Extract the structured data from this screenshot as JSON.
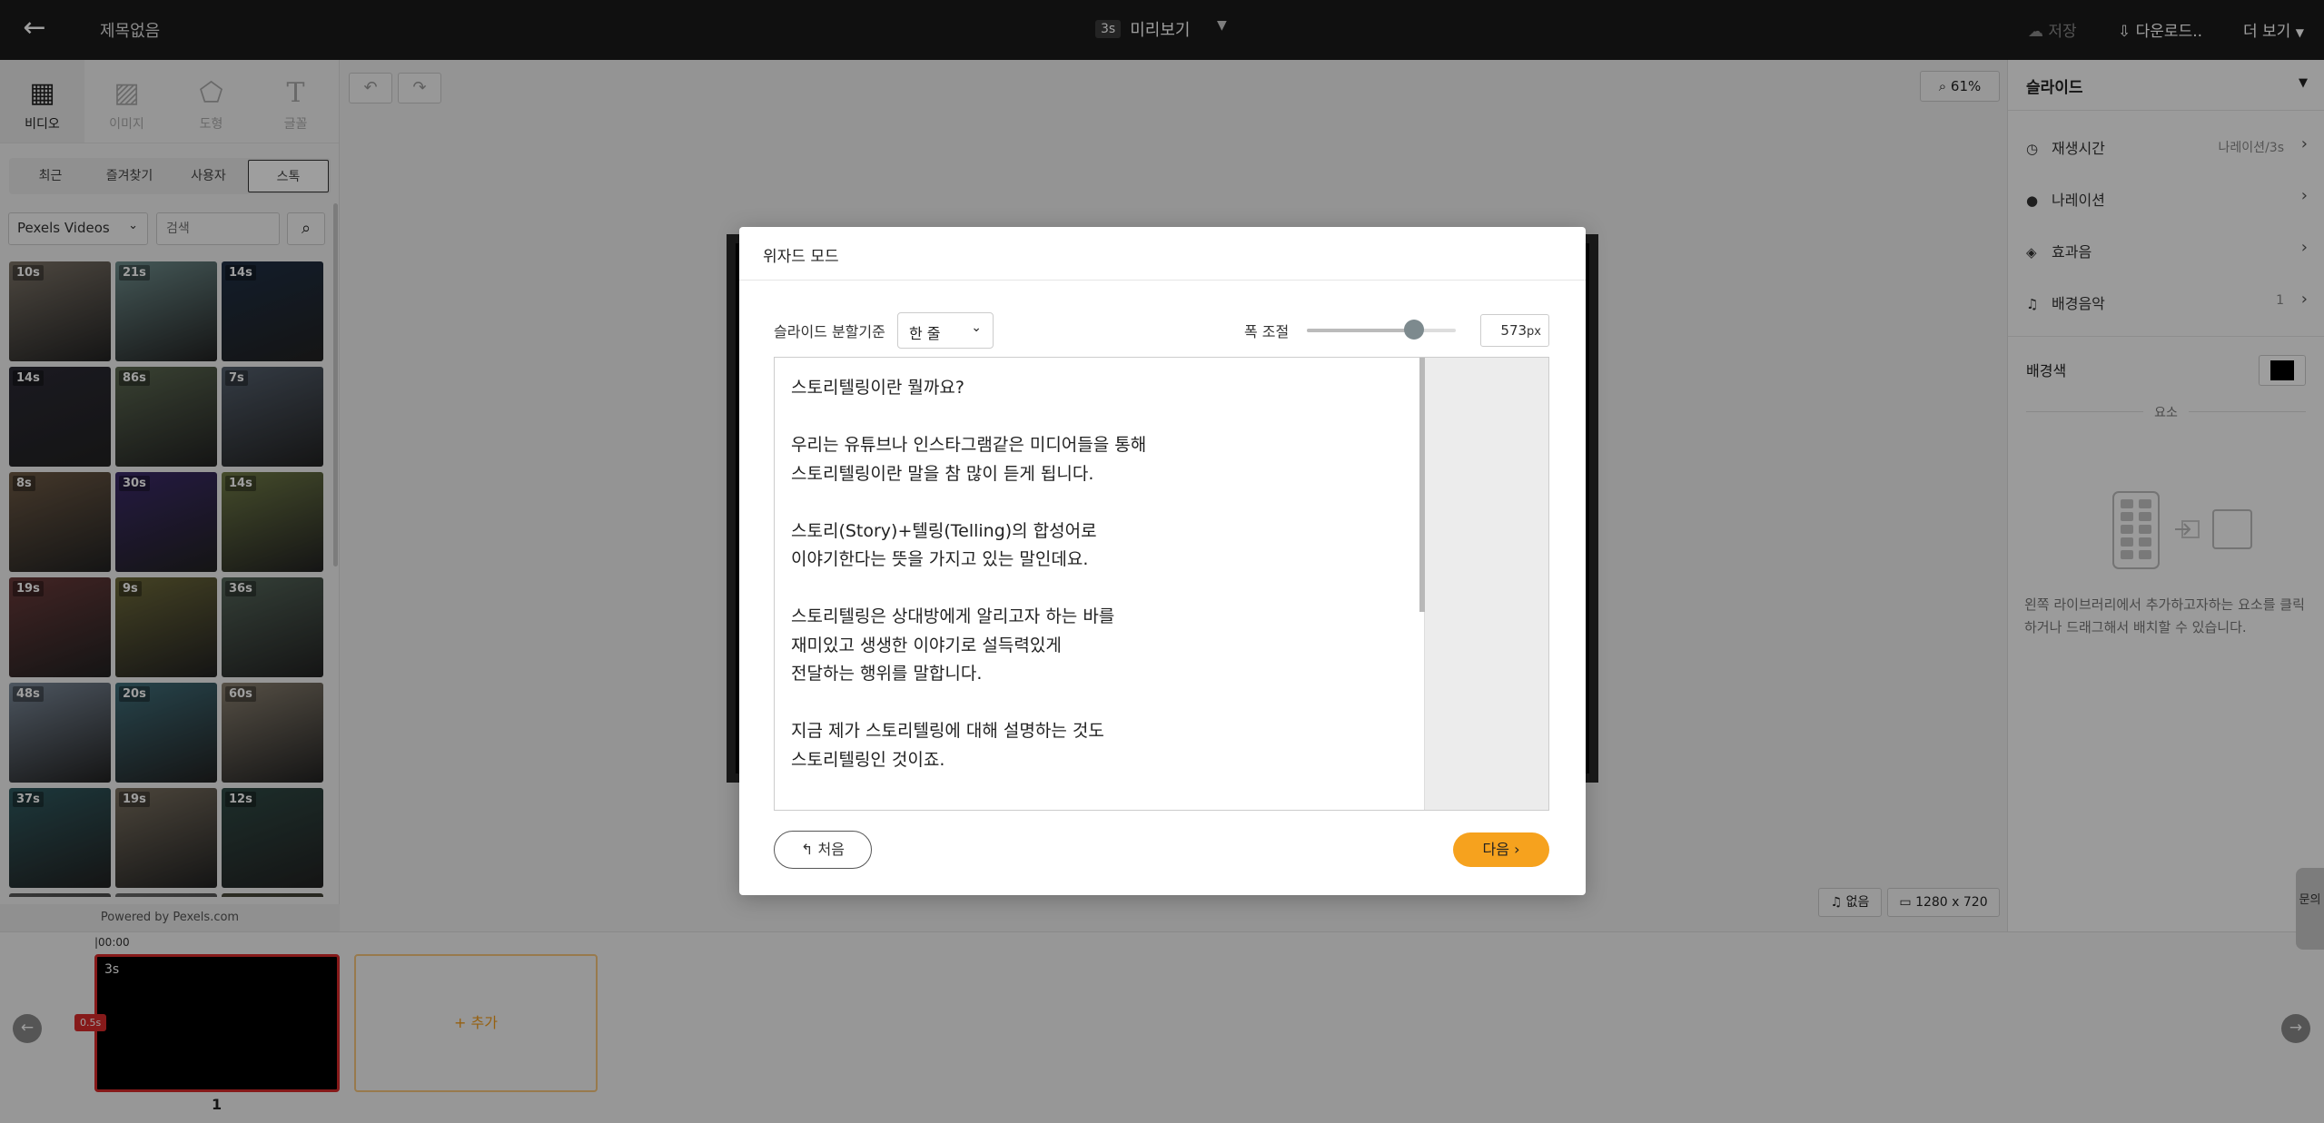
{
  "topbar": {
    "back_icon": "arrow-left-icon",
    "title": "제목없음",
    "duration_badge": "3s",
    "preview_label": "미리보기",
    "save_label": "저장",
    "download_label": "다운로드..",
    "more_label": "더 보기"
  },
  "library": {
    "tabs": [
      {
        "label": "비디오",
        "icon": "film-icon"
      },
      {
        "label": "이미지",
        "icon": "image-icon"
      },
      {
        "label": "도형",
        "icon": "pentagon-icon"
      },
      {
        "label": "글꼴",
        "icon": "text-icon"
      }
    ],
    "sources": [
      "최근",
      "즐겨찾기",
      "사용자",
      "스톡"
    ],
    "provider": "Pexels Videos",
    "search_placeholder": "검색",
    "thumbnails": [
      {
        "dur": "10s",
        "color": "#7d7468"
      },
      {
        "dur": "21s",
        "color": "#6f8e8d"
      },
      {
        "dur": "14s",
        "color": "#1f2f45"
      },
      {
        "dur": "14s",
        "color": "#2b2a35"
      },
      {
        "dur": "86s",
        "color": "#5d6a52"
      },
      {
        "dur": "7s",
        "color": "#55606e"
      },
      {
        "dur": "8s",
        "color": "#6e5a45"
      },
      {
        "dur": "30s",
        "color": "#3b2a6a"
      },
      {
        "dur": "14s",
        "color": "#6f7a46"
      },
      {
        "dur": "19s",
        "color": "#6a3a3a"
      },
      {
        "dur": "9s",
        "color": "#6e6a3a"
      },
      {
        "dur": "36s",
        "color": "#55665a"
      },
      {
        "dur": "48s",
        "color": "#7c8a9a"
      },
      {
        "dur": "20s",
        "color": "#3f6e7a"
      },
      {
        "dur": "60s",
        "color": "#8a8070"
      },
      {
        "dur": "37s",
        "color": "#2f5a60"
      },
      {
        "dur": "19s",
        "color": "#7a7060"
      },
      {
        "dur": "12s",
        "color": "#2f4a45"
      },
      {
        "dur": "",
        "color": "#5a5a5a"
      },
      {
        "dur": "",
        "color": "#6a6a6a"
      },
      {
        "dur": "",
        "color": "#4a4a3a"
      }
    ],
    "powered_by": "Powered by Pexels.com"
  },
  "canvas": {
    "zoom": "61%",
    "audio_label": "없음",
    "resolution": "1280 x 720"
  },
  "right_panel": {
    "title": "슬라이드",
    "rows": [
      {
        "label": "재생시간",
        "value": "나레이션/3s",
        "icon": "clock-icon"
      },
      {
        "label": "나레이션",
        "value": "",
        "icon": "mic-icon"
      },
      {
        "label": "효과음",
        "value": "",
        "icon": "speaker-icon"
      },
      {
        "label": "배경음악",
        "value": "1",
        "icon": "music-icon"
      }
    ],
    "bg_color_label": "배경색",
    "elements_label": "요소",
    "help_text": "왼쪽 라이브러리에서 추가하고자하는 요소를 클릭하거나 드래그해서 배치할 수 있습니다."
  },
  "timeline": {
    "time": "00:00",
    "clip_duration": "3s",
    "marker": "0.5s",
    "slide_number": "1",
    "add_label": "추가"
  },
  "side_tab": "문의",
  "wizard": {
    "title": "위자드 모드",
    "split_label": "슬라이드 분할기준",
    "split_value": "한 줄",
    "width_label": "폭 조절",
    "width_fraction": 0.72,
    "width_value": "573",
    "width_unit": "px",
    "script_lines": [
      "스토리텔링이란 뭘까요?",
      "",
      "우리는 유튜브나 인스타그램같은 미디어들을 통해",
      "스토리텔링이란 말을 참 많이 듣게 됩니다.",
      "",
      "스토리(Story)+텔링(Telling)의 합성어로",
      "이야기한다는 뜻을 가지고 있는 말인데요.",
      "",
      "스토리텔링은 상대방에게 알리고자 하는 바를",
      "재미있고 생생한 이야기로 설득력있게",
      "전달하는 행위를 말합니다.",
      "",
      "지금 제가 스토리텔링에 대해 설명하는 것도",
      "스토리텔링인 것이죠."
    ],
    "first_label": "처음",
    "next_label": "다음"
  }
}
